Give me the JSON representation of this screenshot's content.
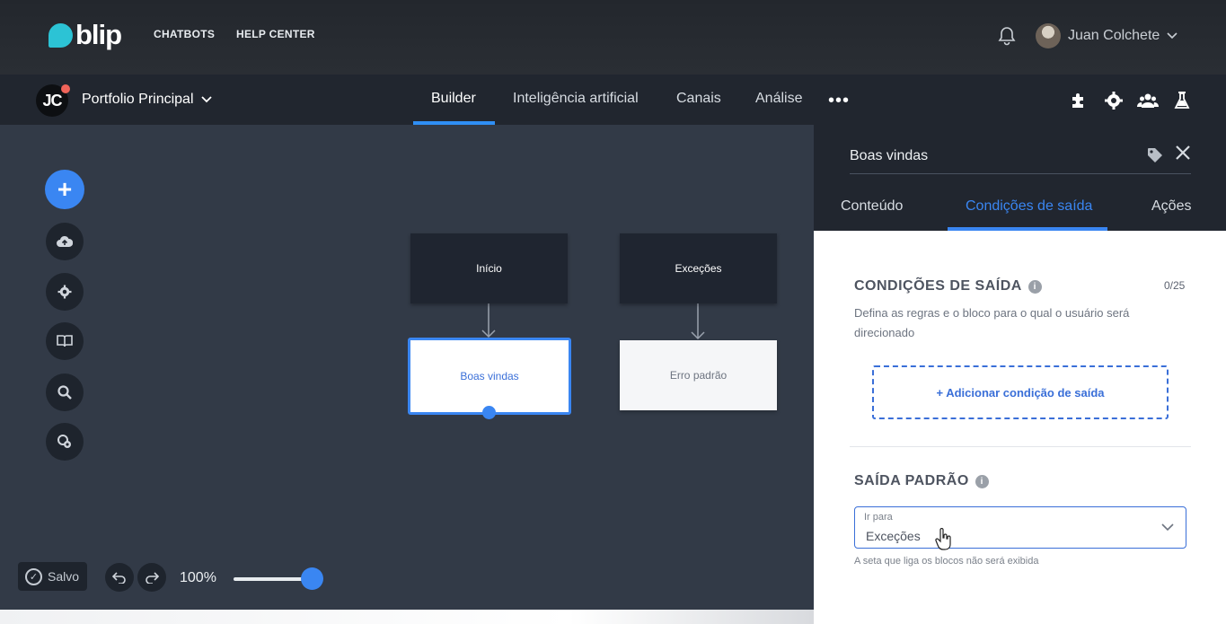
{
  "topbar": {
    "logo_text": "blip",
    "nav": [
      "CHATBOTS",
      "HELP CENTER"
    ],
    "user_name": "Juan Colchete",
    "user_chevron": "⌄"
  },
  "navbar": {
    "avatar_initials": "JC",
    "portfolio": "Portfolio Principal",
    "tabs": [
      "Builder",
      "Inteligência artificial",
      "Canais",
      "Análise"
    ],
    "active_tab": "Builder",
    "more": "•••"
  },
  "canvas": {
    "blocks": {
      "inicio": "Início",
      "excecoes": "Exceções",
      "boas_vindas": "Boas vindas",
      "erro_padrao": "Erro padrão"
    },
    "saved_label": "Salvo",
    "zoom_label": "100%",
    "zoom_level": 1.0
  },
  "panel": {
    "title": "Boas vindas",
    "tabs": [
      "Conteúdo",
      "Condições de saída",
      "Ações"
    ],
    "active_tab": "Condições de saída",
    "exit_conditions_title": "CONDIÇÕES DE SAÍDA",
    "exit_conditions_counter": "0/25",
    "exit_conditions_desc": "Defina as regras e o bloco para o qual o usuário será direcionado",
    "add_condition_label": "+ Adicionar condição de saída",
    "default_exit_title": "SAÍDA PADRÃO",
    "select_label": "Ir para",
    "select_value": "Exceções",
    "hint": "A seta que liga os blocos não será exibida"
  },
  "colors": {
    "accent": "#3a86f2",
    "topbar": "#23272d",
    "canvas": "#323a47",
    "panel_header": "#21262f"
  }
}
